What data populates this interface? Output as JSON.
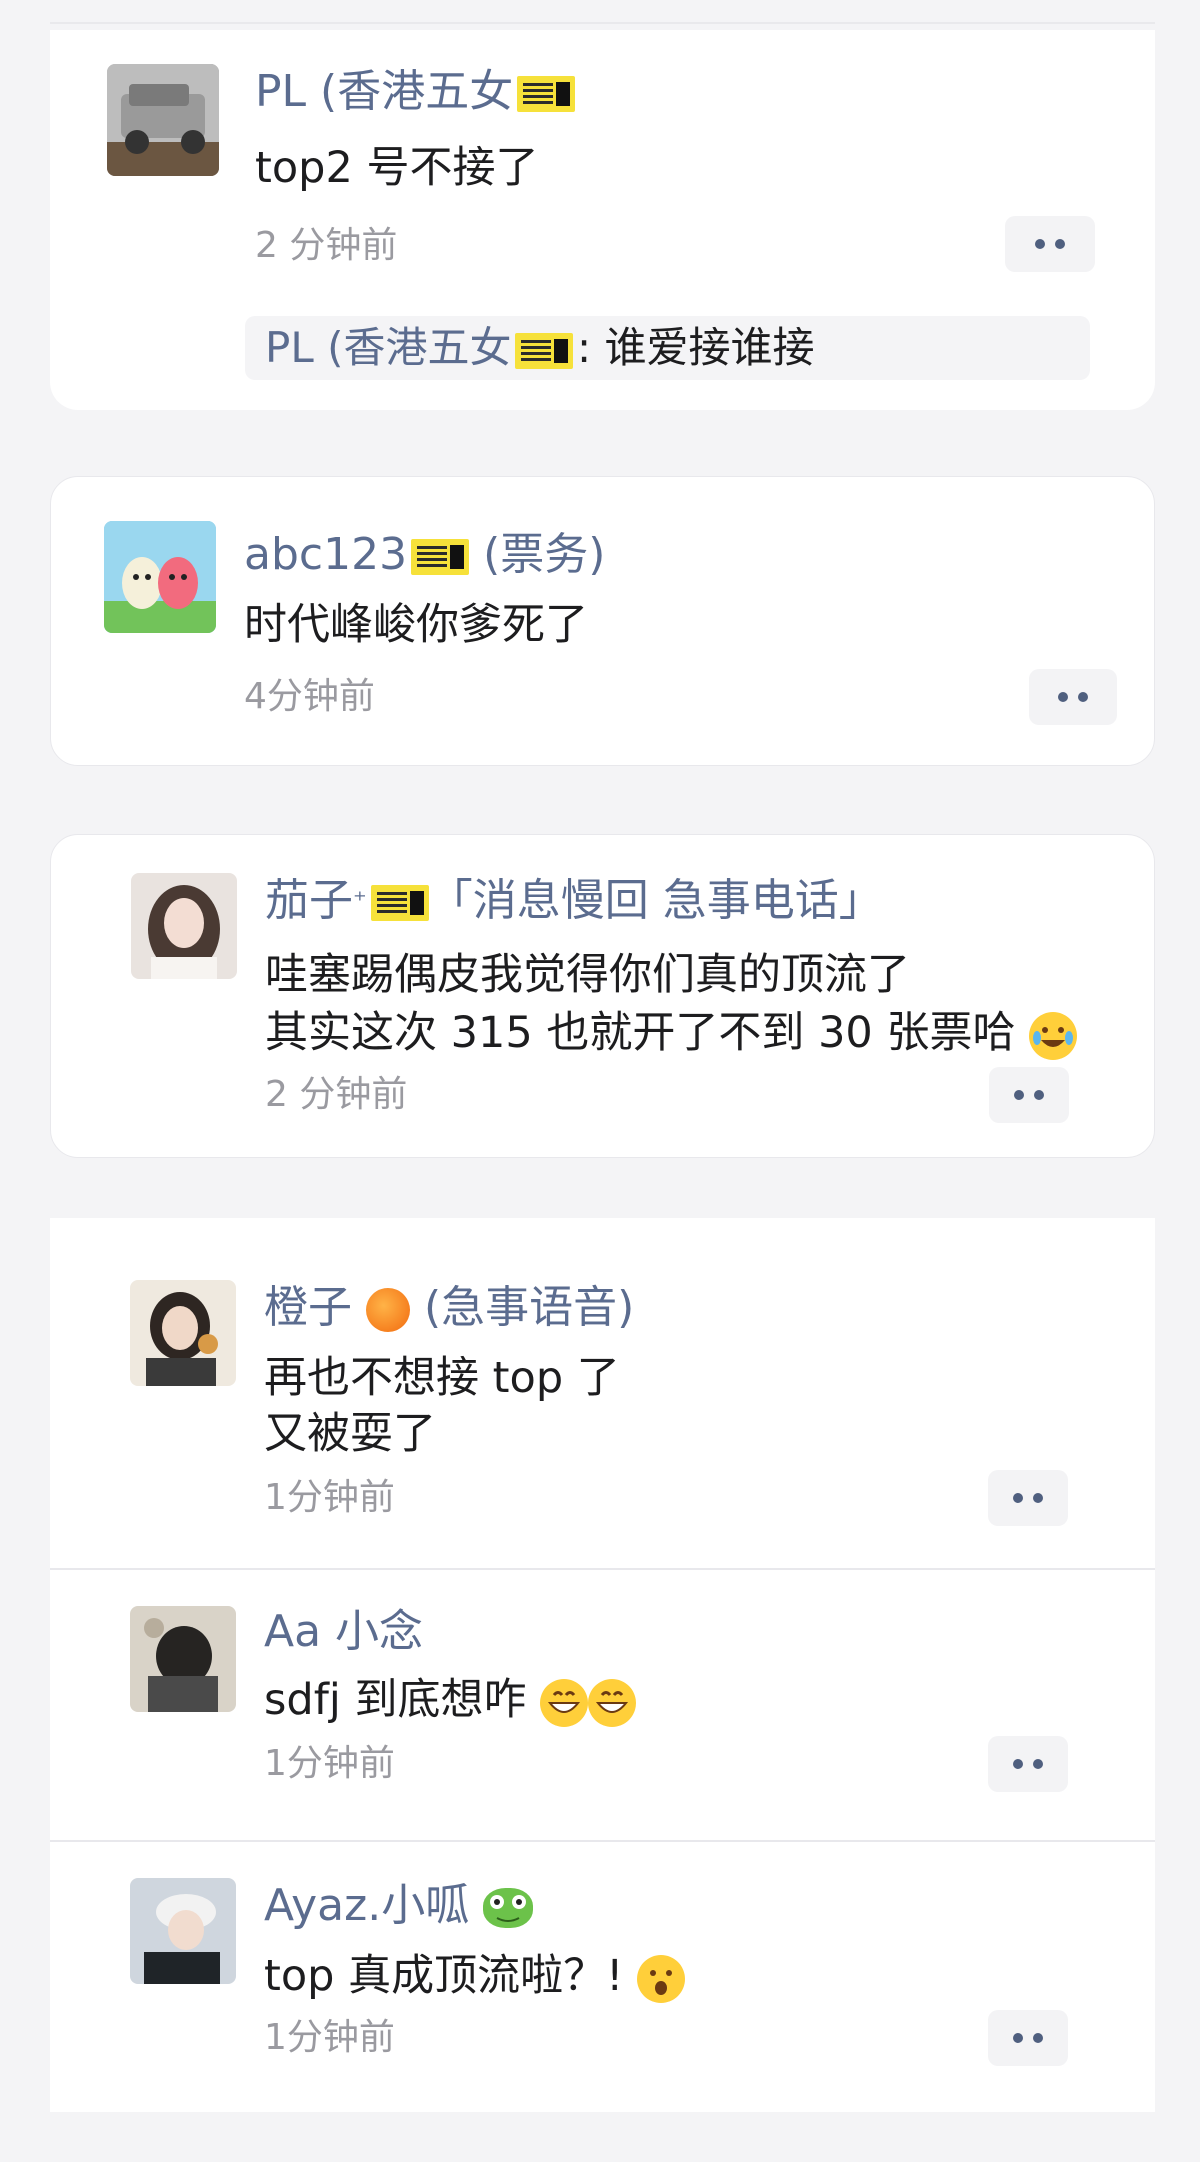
{
  "comments": [
    {
      "name": "PL (香港五女",
      "text": "top2 号不接了",
      "time": "2 分钟前",
      "reply": {
        "name": "PL (香港五女",
        "text": ": 谁爱接谁接"
      }
    },
    {
      "name": "abc123",
      "name_suffix": " (票务)",
      "text": "时代峰峻你爹死了",
      "time": "4分钟前"
    },
    {
      "name": "茄子",
      "name_suffix": "「消息慢回 急事电话」",
      "text_lines": [
        "哇塞踢偶皮我觉得你们真的顶流了",
        "其实这次 315 也就开了不到 30 张票哈"
      ],
      "time": "2 分钟前"
    },
    {
      "name": "橙子",
      "name_suffix": "(急事语音)",
      "text_lines": [
        "再也不想接 top 了",
        "又被耍了"
      ],
      "time": "1分钟前"
    },
    {
      "name": "Aa 小念",
      "text": "sdfj 到底想咋",
      "time": "1分钟前"
    },
    {
      "name": "Ayaz.小呱",
      "text": "top 真成顶流啦？!",
      "time": "1分钟前"
    }
  ],
  "icons": {
    "ticket": "concert-ticket-icon",
    "orange": "tangerine-emoji",
    "frog": "frog-emoji",
    "crying_laugh": "rolling-laughing-emoji",
    "grin": "grinning-emoji",
    "surprised": "hushed-emoji",
    "more": "more-dots-icon"
  },
  "colors": {
    "name": "#5b6c8f",
    "text": "#1d1d1f",
    "time": "#9a9aa0",
    "background": "#f4f4f6"
  }
}
